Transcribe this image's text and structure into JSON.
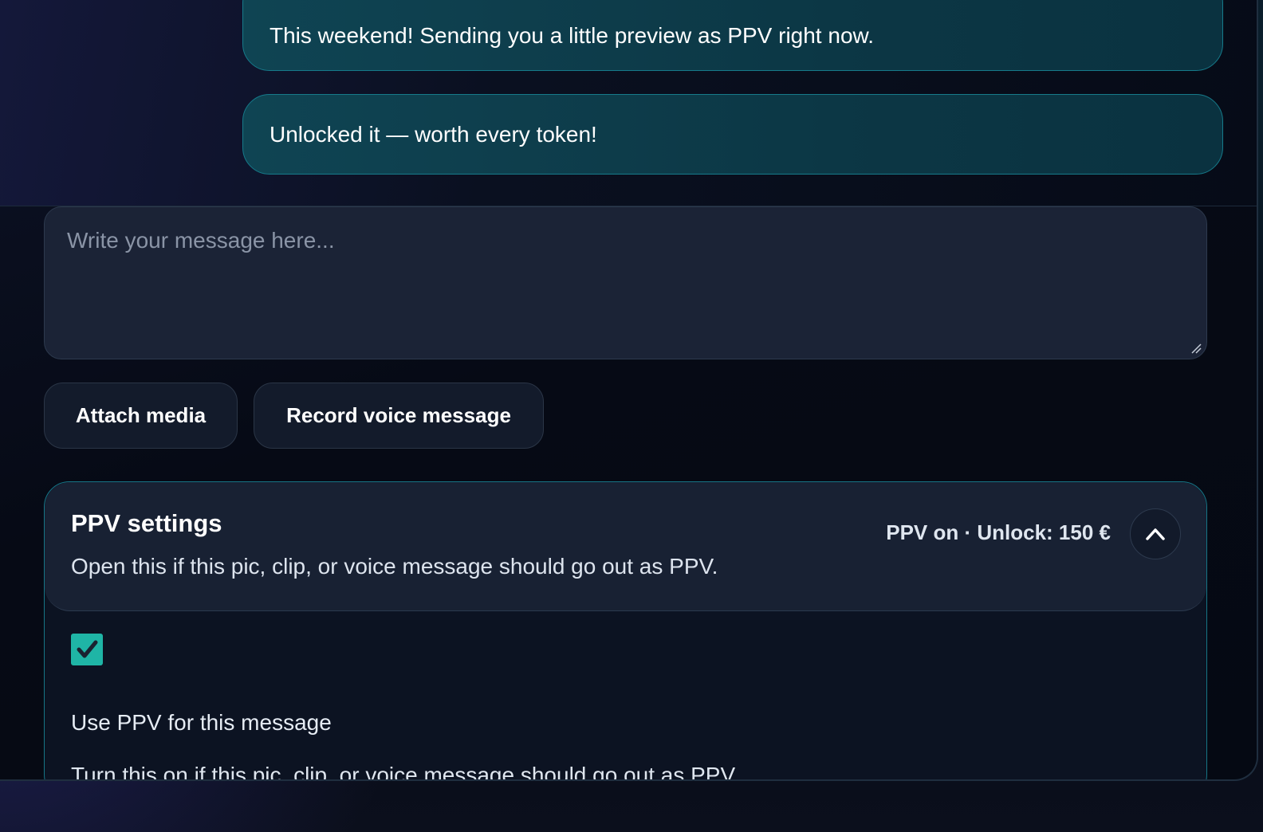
{
  "thread": {
    "messages": [
      {
        "text": "This weekend! Sending you a little preview as PPV right now."
      },
      {
        "text": "Unlocked it — worth every token!"
      }
    ]
  },
  "composer": {
    "placeholder": "Write your message here..."
  },
  "actions": {
    "attach_label": "Attach media",
    "record_label": "Record voice message"
  },
  "ppv": {
    "title": "PPV settings",
    "description": "Open this if this pic, clip, or voice message should go out as PPV.",
    "status": "PPV on · Unlock: 150 €",
    "checked": true,
    "option_label": "Use PPV for this message",
    "option_help": "Turn this on if this pic, clip, or voice message should go out as PPV."
  },
  "colors": {
    "accent": "#1fb5a6",
    "bubble_border": "#167a8a"
  }
}
